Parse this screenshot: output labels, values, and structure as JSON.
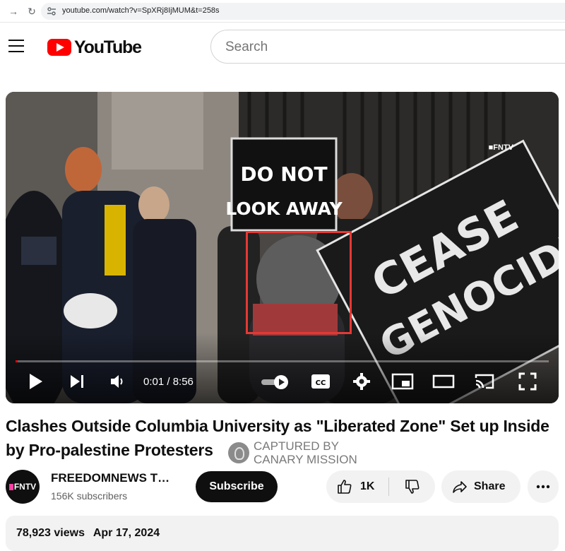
{
  "browser": {
    "url": "youtube.com/watch?v=SpXRj8IjMUM&t=258s"
  },
  "header": {
    "logo_text": "YouTube",
    "search_placeholder": "Search"
  },
  "video": {
    "watermark": "FNTV",
    "sign_left": [
      "DO NOT",
      "LOOK AWAY"
    ],
    "sign_right": [
      "CEASE",
      "GENOCIDE"
    ],
    "current_time": "0:01",
    "duration": "8:56",
    "time_display": "0:01 / 8:56",
    "progress_fraction": 0.002,
    "autoplay_on": true,
    "cc_label": "CC"
  },
  "title": "Clashes Outside Columbia University as \"Liberated Zone\" Set up Inside by Pro-palestine Protesters",
  "badge": {
    "line1": "CAPTURED BY",
    "line2": "CANARY MISSION"
  },
  "channel": {
    "avatar_text": "FNTV",
    "name": "FREEDOMNEWS T…",
    "subscribers": "156K subscribers",
    "subscribe_label": "Subscribe"
  },
  "actions": {
    "like_count": "1K",
    "share_label": "Share"
  },
  "description": {
    "views": "78,923 views",
    "date": "Apr 17, 2024"
  },
  "colors": {
    "brand_red": "#ff0000",
    "highlight_box": "#e53935"
  }
}
